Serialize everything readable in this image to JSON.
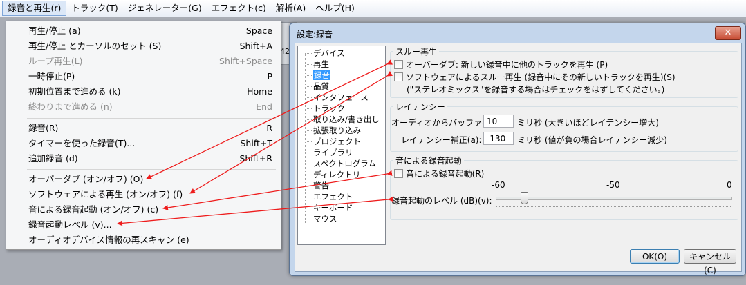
{
  "menubar": {
    "items": [
      "録音と再生(r)",
      "トラック(T)",
      "ジェネレーター(G)",
      "エフェクト(c)",
      "解析(A)",
      "ヘルプ(H)"
    ]
  },
  "background": {
    "toolbar_text": "42 -"
  },
  "menu": {
    "items": [
      {
        "label": "再生/停止 (a)",
        "key": "Space",
        "disabled": false
      },
      {
        "label": "再生/停止 とカーソルのセット (S)",
        "key": "Shift+A",
        "disabled": false
      },
      {
        "label": "ループ再生(L)",
        "key": "Shift+Space",
        "disabled": true
      },
      {
        "label": "一時停止(P)",
        "key": "P",
        "disabled": false
      },
      {
        "label": "初期位置まで進める (k)",
        "key": "Home",
        "disabled": false
      },
      {
        "label": "終わりまで進める (n)",
        "key": "End",
        "disabled": true
      },
      {
        "label": "録音(R)",
        "key": "R",
        "disabled": false
      },
      {
        "label": "タイマーを使った録音(T)...",
        "key": "Shift+T",
        "disabled": false
      },
      {
        "label": "追加録音 (d)",
        "key": "Shift+R",
        "disabled": false
      },
      {
        "label": "オーバーダブ (オン/オフ) (O)",
        "key": "",
        "disabled": false
      },
      {
        "label": "ソフトウェアによる再生 (オン/オフ) (f)",
        "key": "",
        "disabled": false
      },
      {
        "label": "音による録音起動 (オン/オフ) (c)",
        "key": "",
        "disabled": false
      },
      {
        "label": "録音起動レベル (v)...",
        "key": "",
        "disabled": false
      },
      {
        "label": "オーディオデバイス情報の再スキャン (e)",
        "key": "",
        "disabled": false
      }
    ]
  },
  "dialog": {
    "title": "設定:録音",
    "close_label": "✕",
    "tree": [
      "デバイス",
      "再生",
      "録音",
      "品質",
      "インタフェース",
      "トラック",
      "取り込み/書き出し",
      "拡張取り込み",
      "プロジェクト",
      "ライブラリ",
      "スペクトログラム",
      "ディレクトリ",
      "警告",
      "エフェクト",
      "キーボード",
      "マウス"
    ],
    "selected_tree_index": 2,
    "playthrough": {
      "title": "スルー再生",
      "overdub_label": "オーバーダブ: 新しい録音中に他のトラックを再生 (P)",
      "software_label": "ソフトウェアによるスルー再生 (録音中にその新しいトラックを再生)(S)",
      "note": "(\"ステレオミックス\"を録音する場合はチェックをはずしてください。)"
    },
    "latency": {
      "title": "レイテンシー",
      "buffer_label": "オーディオからバッファへ(b):",
      "buffer_value": "10",
      "buffer_unit": "ミリ秒 (大きいほどレイテンシー増大)",
      "correction_label": "レイテンシー補正(a):",
      "correction_value": "-130",
      "correction_unit": "ミリ秒 (値が負の場合レイテンシー減少)"
    },
    "voice_activated": {
      "title": "音による録音起動",
      "checkbox_label": "音による録音起動(R)",
      "scale": [
        "-60",
        "-50",
        "0"
      ],
      "level_label": "録音起動のレベル (dB)(v):",
      "level_fraction": 0.12
    },
    "ok_label": "OK(O)",
    "cancel_label": "キャンセル(C)"
  },
  "colors": {
    "arrow": "#ee1c1c",
    "selection": "#3399ff"
  }
}
